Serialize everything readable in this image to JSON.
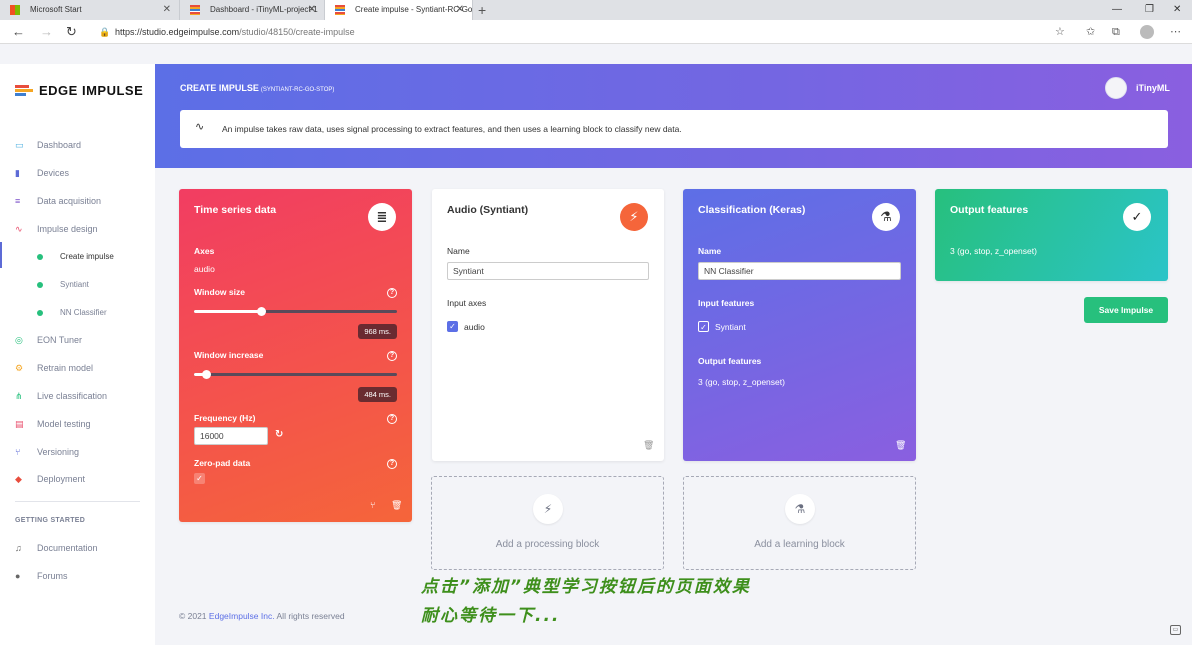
{
  "browser": {
    "tabs": [
      {
        "title": "Microsoft Start"
      },
      {
        "title": "Dashboard - iTinyML-project-1"
      },
      {
        "title": "Create impulse - Syntiant-RC-Go"
      }
    ],
    "tab_close": "✕",
    "new_tab": "+",
    "url_host": "https://studio.edgeimpulse.com",
    "url_path": "/studio/48150/create-impulse"
  },
  "sidebar": {
    "brand": "EDGE IMPULSE",
    "items": [
      {
        "label": "Dashboard"
      },
      {
        "label": "Devices"
      },
      {
        "label": "Data acquisition"
      },
      {
        "label": "Impulse design"
      },
      {
        "label": "EON Tuner"
      },
      {
        "label": "Retrain model"
      },
      {
        "label": "Live classification"
      },
      {
        "label": "Model testing"
      },
      {
        "label": "Versioning"
      },
      {
        "label": "Deployment"
      }
    ],
    "subitems": [
      {
        "label": "Create impulse"
      },
      {
        "label": "Syntiant"
      },
      {
        "label": "NN Classifier"
      }
    ],
    "section_header": "GETTING STARTED",
    "getting_started": [
      {
        "label": "Documentation"
      },
      {
        "label": "Forums"
      }
    ]
  },
  "header": {
    "title": "CREATE IMPULSE",
    "subtitle": "(SYNTIANT-RC-GO-STOP)",
    "user": "iTinyML",
    "info": "An impulse takes raw data, uses signal processing to extract features, and then uses a learning block to classify new data."
  },
  "time_series": {
    "title": "Time series data",
    "axes_label": "Axes",
    "axes_value": "audio",
    "window_size_label": "Window size",
    "window_size_value": "968 ms.",
    "window_size_fraction": 0.33,
    "window_increase_label": "Window increase",
    "window_increase_value": "484 ms.",
    "window_increase_fraction": 0.06,
    "frequency_label": "Frequency (Hz)",
    "frequency_value": "16000",
    "zeropad_label": "Zero-pad data",
    "zeropad_checked": true
  },
  "audio_block": {
    "title": "Audio (Syntiant)",
    "name_label": "Name",
    "name_value": "Syntiant",
    "input_axes_label": "Input axes",
    "input_axes_value": "audio"
  },
  "classification_block": {
    "title": "Classification (Keras)",
    "name_label": "Name",
    "name_value": "NN Classifier",
    "input_features_label": "Input features",
    "input_features_value": "Syntiant",
    "output_features_label": "Output features",
    "output_features_value": "3 (go, stop, z_openset)"
  },
  "output_block": {
    "title": "Output features",
    "value": "3 (go, stop, z_openset)"
  },
  "add_processing": "Add a processing block",
  "add_learning": "Add a learning block",
  "save_button": "Save Impulse",
  "footer": {
    "copyright": "© 2021",
    "company": "EdgeImpulse Inc.",
    "rights": "All rights reserved"
  },
  "annotation": {
    "line1": "点击”添加”典型学习按钮后的页面效果",
    "line2": "耐心等待一下..."
  },
  "colors": {
    "accent": "#5c6fe6",
    "time_series_gradient": [
      "#f23d62",
      "#f5653a"
    ],
    "classification_gradient": [
      "#5d6fe6",
      "#8a5fe0"
    ],
    "output_gradient": [
      "#27c07d",
      "#2bc4c8"
    ],
    "audio_badge": "#f5653a",
    "save_button": "#27c07d"
  }
}
